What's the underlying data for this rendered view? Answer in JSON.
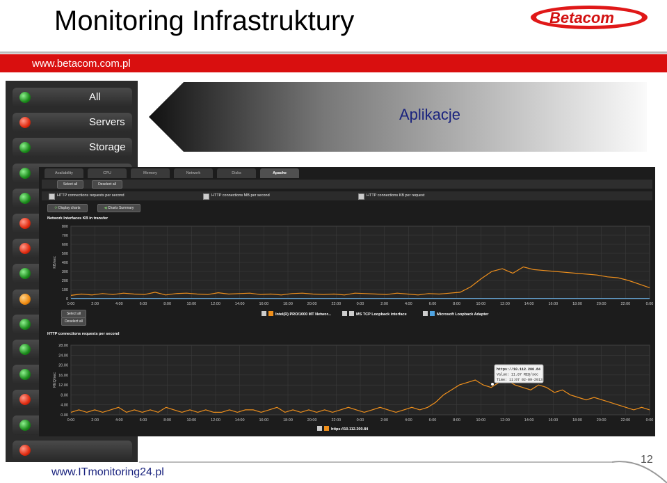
{
  "slide": {
    "title": "Monitoring Infrastruktury",
    "top_url": "www.betacom.com.pl",
    "footer_url": "www.ITmonitoring24.pl",
    "page_number": "12",
    "banner": "Aplikacje",
    "logo_text": "Betacom"
  },
  "status_panel": {
    "items": [
      {
        "label": "All",
        "status": "green"
      },
      {
        "label": "Servers",
        "status": "red"
      },
      {
        "label": "Storage",
        "status": "green"
      },
      {
        "label": "",
        "status": "green"
      },
      {
        "label": "",
        "status": "green"
      },
      {
        "label": "",
        "status": "red"
      },
      {
        "label": "",
        "status": "red"
      },
      {
        "label": "",
        "status": "green"
      },
      {
        "label": "",
        "status": "orange"
      },
      {
        "label": "",
        "status": "green"
      },
      {
        "label": "",
        "status": "green"
      },
      {
        "label": "",
        "status": "green"
      },
      {
        "label": "",
        "status": "red"
      },
      {
        "label": "",
        "status": "green"
      },
      {
        "label": "",
        "status": "red"
      }
    ]
  },
  "app": {
    "tabs": [
      "Availability",
      "CPU",
      "Memory",
      "Network",
      "Disks",
      "Apache"
    ],
    "active_tab": "Apache",
    "toolbar": {
      "select_all": "Select all",
      "deselect_all": "Deselect all"
    },
    "checkboxes": [
      "HTTP connections requests per second",
      "HTTP connections MB per second",
      "HTTP connections KB per request"
    ],
    "actions": {
      "display_charts": "Display charts",
      "charts_summary": "Charts Summary"
    },
    "chart1_select_all": "Select all",
    "chart1_deselect_all": "Deselect all"
  },
  "chart_data": [
    {
      "type": "line",
      "title": "Network Interfaces KB in transfer",
      "ylabel": "KB/sec",
      "ylim": [
        0,
        800
      ],
      "yticks": [
        "800",
        "700",
        "600",
        "500",
        "400",
        "300",
        "200",
        "100",
        "0"
      ],
      "xticks": [
        "0:00",
        "2:00",
        "4:00",
        "6:00",
        "8:00",
        "10:00",
        "12:00",
        "14:00",
        "16:00",
        "18:00",
        "20:00",
        "22:00",
        "0:00",
        "2:00",
        "4:00",
        "6:00",
        "8:00",
        "10:00",
        "12:00",
        "14:00",
        "16:00",
        "18:00",
        "20:00",
        "22:00",
        "0:00"
      ],
      "series": [
        {
          "name": "Intel(R) PRO/1000 MT Networ...",
          "color": "#f0901c",
          "values": [
            35,
            50,
            40,
            55,
            45,
            60,
            50,
            45,
            70,
            40,
            55,
            60,
            50,
            45,
            65,
            50,
            55,
            60,
            45,
            50,
            40,
            55,
            60,
            50,
            45,
            50,
            40,
            60,
            55,
            50,
            45,
            60,
            50,
            40,
            55,
            50,
            60,
            70,
            130,
            220,
            300,
            330,
            280,
            350,
            320,
            310,
            300,
            290,
            280,
            270,
            260,
            240,
            230,
            200,
            160,
            120
          ]
        },
        {
          "name": "MS TCP Loopback interface",
          "color": "#cccccc",
          "values": [
            0,
            0,
            0,
            0,
            0,
            0,
            0,
            0,
            0,
            0
          ]
        },
        {
          "name": "Microsoft Loopback Adapter",
          "color": "#4fa3e0",
          "values": [
            2,
            2,
            2,
            2,
            2,
            2,
            2,
            2,
            2,
            2
          ]
        }
      ]
    },
    {
      "type": "line",
      "title": "HTTP connections requests per second",
      "ylabel": "REQ/sec",
      "ylim": [
        0,
        28
      ],
      "yticks": [
        "28.00",
        "24.00",
        "20.00",
        "16.00",
        "12.00",
        "8.00",
        "4.00",
        "0.00"
      ],
      "xticks": [
        "0:00",
        "2:00",
        "4:00",
        "6:00",
        "8:00",
        "10:00",
        "12:00",
        "14:00",
        "16:00",
        "18:00",
        "20:00",
        "22:00",
        "0:00",
        "2:00",
        "4:00",
        "6:00",
        "8:00",
        "10:00",
        "12:00",
        "14:00",
        "16:00",
        "18:00",
        "20:00",
        "22:00",
        "0:00"
      ],
      "series": [
        {
          "name": "https://10.112.200.84",
          "color": "#f0901c",
          "values": [
            1,
            2,
            1,
            2,
            1,
            2,
            3,
            1,
            2,
            1,
            2,
            1,
            3,
            2,
            1,
            2,
            1,
            2,
            1,
            1,
            2,
            1,
            2,
            2,
            1,
            2,
            3,
            1,
            2,
            1,
            2,
            1,
            2,
            1,
            2,
            3,
            2,
            1,
            2,
            3,
            2,
            1,
            2,
            3,
            2,
            3,
            5,
            8,
            10,
            12,
            13,
            14,
            12,
            11,
            13,
            14,
            12,
            11,
            10,
            12,
            11,
            9,
            10,
            8,
            7,
            6,
            7,
            6,
            5,
            4,
            3,
            2,
            3,
            2
          ]
        }
      ],
      "tooltip": {
        "line1": "https://10.112.200.84",
        "line2": "Value: 11.87 REQ/sec",
        "line3": "Time: 11:07 02-09-2013"
      }
    }
  ]
}
